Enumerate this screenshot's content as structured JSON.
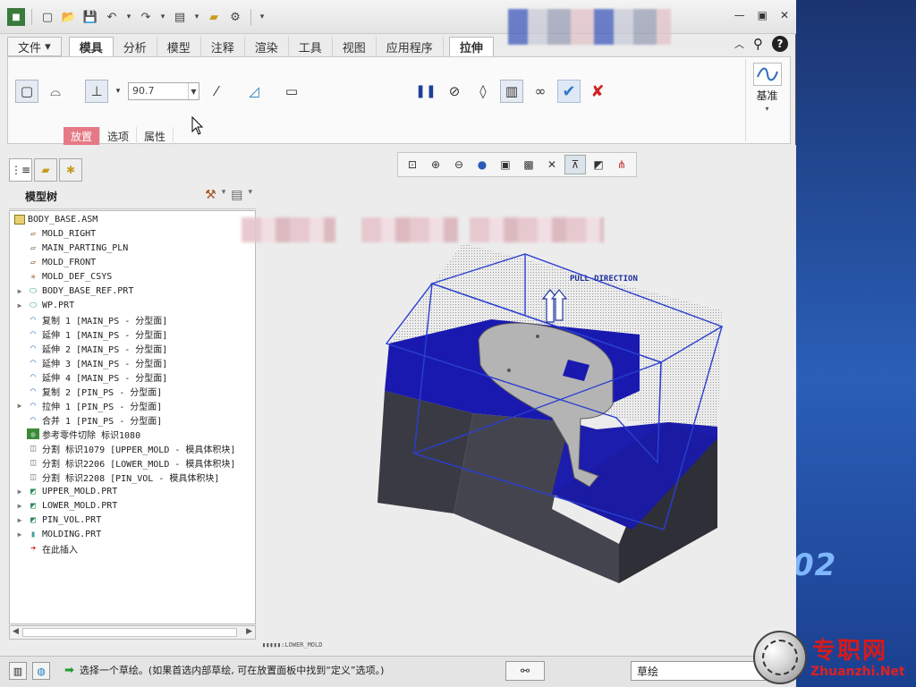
{
  "titlebar": {
    "quick_access": [
      "new-icon",
      "open-icon",
      "save-icon",
      "undo-icon",
      "redo-icon",
      "window-icon",
      "folder-icon",
      "regenerate-icon"
    ],
    "controls": [
      "minimize-icon",
      "maximize-icon",
      "close-icon"
    ]
  },
  "ribbon": {
    "tabs": [
      "文件",
      "模具",
      "分析",
      "模型",
      "注释",
      "渲染",
      "工具",
      "视图",
      "应用程序",
      "拉伸"
    ],
    "active_tab": "拉伸",
    "depth_value": "90.7",
    "subtabs": [
      "放置",
      "选项",
      "属性"
    ],
    "datum_label": "基准"
  },
  "navigator": {
    "title": "模型树",
    "items": [
      {
        "label": "BODY_BASE.ASM",
        "icon": "assembly-icon",
        "expand": ""
      },
      {
        "label": "MOLD_RIGHT",
        "icon": "datum-plane-icon",
        "expand": ""
      },
      {
        "label": "MAIN_PARTING_PLN",
        "icon": "datum-plane-icon",
        "expand": ""
      },
      {
        "label": "MOLD_FRONT",
        "icon": "datum-plane-icon",
        "expand": ""
      },
      {
        "label": "MOLD_DEF_CSYS",
        "icon": "csys-icon",
        "expand": ""
      },
      {
        "label": "BODY_BASE_REF.PRT",
        "icon": "part-icon",
        "expand": "▶"
      },
      {
        "label": "WP.PRT",
        "icon": "part-icon",
        "expand": "▶"
      },
      {
        "label": "复制 1 [MAIN_PS - 分型面]",
        "icon": "surface-icon",
        "expand": ""
      },
      {
        "label": "延伸 1 [MAIN_PS - 分型面]",
        "icon": "surface-icon",
        "expand": ""
      },
      {
        "label": "延伸 2 [MAIN_PS - 分型面]",
        "icon": "surface-icon",
        "expand": ""
      },
      {
        "label": "延伸 3 [MAIN_PS - 分型面]",
        "icon": "surface-icon",
        "expand": ""
      },
      {
        "label": "延伸 4 [MAIN_PS - 分型面]",
        "icon": "surface-icon",
        "expand": ""
      },
      {
        "label": "复制 2 [PIN_PS - 分型面]",
        "icon": "surface-icon",
        "expand": ""
      },
      {
        "label": "拉伸 1 [PIN_PS - 分型面]",
        "icon": "surface-icon",
        "expand": "▶"
      },
      {
        "label": "合并 1 [PIN_PS - 分型面]",
        "icon": "surface-icon",
        "expand": ""
      },
      {
        "label": "参考零件切除 标识1080",
        "icon": "cut-icon",
        "expand": ""
      },
      {
        "label": "分割 标识1079 [UPPER_MOLD - 模具体积块]",
        "icon": "split-icon",
        "expand": ""
      },
      {
        "label": "分割 标识2206 [LOWER_MOLD - 模具体积块]",
        "icon": "split-icon",
        "expand": ""
      },
      {
        "label": "分割 标识2208 [PIN_VOL - 模具体积块]",
        "icon": "split-icon",
        "expand": ""
      },
      {
        "label": "UPPER_MOLD.PRT",
        "icon": "mold-part-icon",
        "expand": "▶"
      },
      {
        "label": "LOWER_MOLD.PRT",
        "icon": "mold-part-icon",
        "expand": "▶"
      },
      {
        "label": "PIN_VOL.PRT",
        "icon": "mold-part-icon",
        "expand": "▶"
      },
      {
        "label": "MOLDING.PRT",
        "icon": "molding-icon",
        "expand": "▶"
      },
      {
        "label": "在此插入",
        "icon": "insert-here-icon",
        "expand": ""
      }
    ]
  },
  "graphics": {
    "annotation": "PULL DIRECTION",
    "status_text": "LOWER_MOLD",
    "colors": {
      "mold_blue": "#1a1aa8",
      "steel": "#3d3d48",
      "part": "#b8b8b8",
      "wire": "#2a3fd0"
    }
  },
  "statusbar": {
    "message": "选择一个草绘。(如果首选内部草绘, 可在放置面板中找到“定义”选项。)",
    "filter": "草绘"
  },
  "watermark": {
    "cn": "专职网",
    "en": "Zhuanzhi.Net"
  },
  "desktop": {
    "text": "02"
  }
}
